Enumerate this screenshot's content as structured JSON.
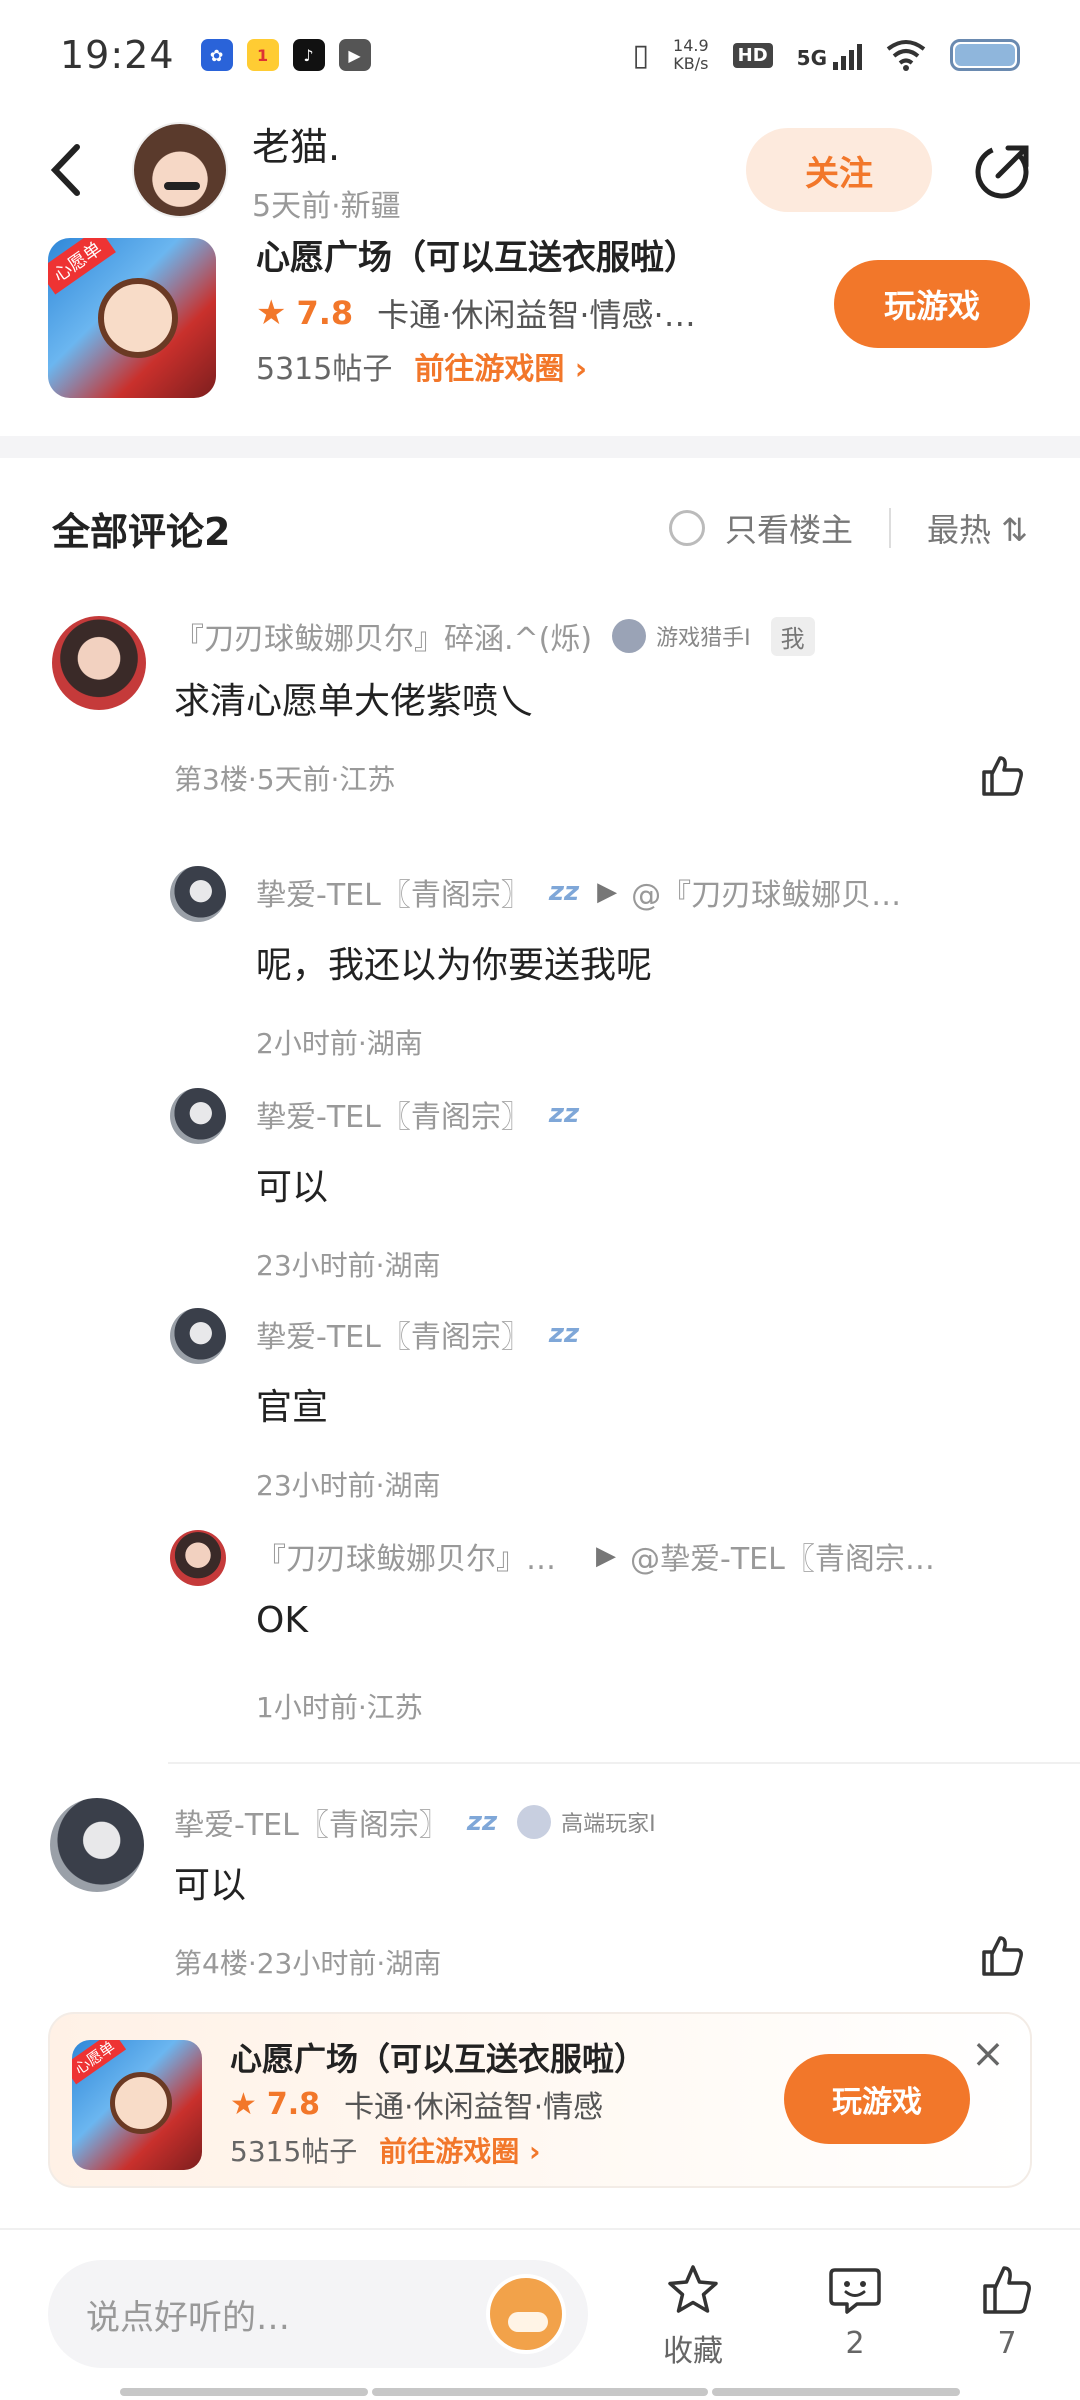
{
  "status_bar": {
    "time": "19:24",
    "net_speed": "14.9",
    "net_unit": "KB/s",
    "hd": "HD",
    "network": "5G"
  },
  "header": {
    "user_name": "老猫.",
    "user_sub": "5天前·新疆",
    "follow_label": "关注"
  },
  "game": {
    "title": "心愿广场（可以互送衣服啦）",
    "rating": "7.8",
    "tags": "卡通·休闲益智·情感·…",
    "posts": "5315帖子",
    "circle_link": "前往游戏圈 ›",
    "play_label": "玩游戏",
    "thumb_tag": "心愿单"
  },
  "comments_header": {
    "title": "全部评论2",
    "only_host": "只看楼主",
    "sort": "最热 ⇅"
  },
  "comments": [
    {
      "name": "『刀刃球鲅娜贝尔』碎涵.^(烁)",
      "medal": "游戏猎手Ⅰ",
      "mine_badge": "我",
      "text": "求清心愿单大佬紫喷乀",
      "meta": "第3楼·5天前·江苏",
      "replies": [
        {
          "name": "挚爱-TEL〖青阁宗〗",
          "zzz": "zz",
          "arrow": "▶",
          "target": "@『刀刃球鲅娜贝…",
          "text": "呢，我还以为你要送我呢",
          "meta": "2小时前·湖南"
        },
        {
          "name": "挚爱-TEL〖青阁宗〗",
          "zzz": "zz",
          "text": "可以",
          "meta": "23小时前·湖南"
        },
        {
          "name": "挚爱-TEL〖青阁宗〗",
          "zzz": "zz",
          "text": "官宣",
          "meta": "23小时前·湖南"
        },
        {
          "name": "『刀刃球鲅娜贝尔』…",
          "arrow": "▶",
          "target": "@挚爱-TEL〖青阁宗…",
          "text": "OK",
          "meta": "1小时前·江苏"
        }
      ]
    },
    {
      "name": "挚爱-TEL〖青阁宗〗",
      "zzz": "zz",
      "medal": "高端玩家Ⅰ",
      "text": "可以",
      "meta": "第4楼·23小时前·湖南"
    }
  ],
  "banner": {
    "title": "心愿广场（可以互送衣服啦）",
    "rating": "7.8",
    "tags": "卡通·休闲益智·情感",
    "posts": "5315帖子",
    "circle_link": "前往游戏圈 ›",
    "play_label": "玩游戏",
    "close": "×",
    "thumb_tag": "心愿单"
  },
  "bottom_bar": {
    "input_placeholder": "说点好听的…",
    "favorite_label": "收藏",
    "comment_count": "2",
    "like_count": "7"
  },
  "colors": {
    "accent": "#f2772a",
    "follow_bg": "#fdeadd",
    "muted": "#999999"
  }
}
